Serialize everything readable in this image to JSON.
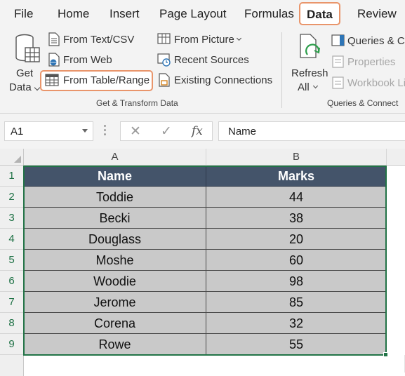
{
  "ribbon_tabs": {
    "file": "File",
    "home": "Home",
    "insert": "Insert",
    "page_layout": "Page Layout",
    "formulas": "Formulas",
    "data": "Data",
    "review": "Review"
  },
  "get_transform": {
    "get_data_line1": "Get",
    "get_data_line2": "Data",
    "from_text_csv": "From Text/CSV",
    "from_web": "From Web",
    "from_table_range": "From Table/Range",
    "from_picture": "From Picture",
    "recent_sources": "Recent Sources",
    "existing_connections": "Existing Connections",
    "group_label": "Get & Transform Data"
  },
  "queries": {
    "refresh_line1": "Refresh",
    "refresh_line2": "All",
    "queries_connections": "Queries & Co",
    "properties": "Properties",
    "workbook_links": "Workbook Li",
    "group_label": "Queries & Connect"
  },
  "formula_bar": {
    "name_box": "A1",
    "cancel_glyph": "✕",
    "enter_glyph": "✓",
    "fx_glyph": "fx",
    "formula": "Name"
  },
  "sheet": {
    "columns": [
      "A",
      "B"
    ],
    "row_numbers": [
      "1",
      "2",
      "3",
      "4",
      "5",
      "6",
      "7",
      "8",
      "9"
    ],
    "headers": [
      "Name",
      "Marks"
    ],
    "rows": [
      [
        "Toddie",
        "44"
      ],
      [
        "Becki",
        "38"
      ],
      [
        "Douglass",
        "20"
      ],
      [
        "Moshe",
        "60"
      ],
      [
        "Woodie",
        "98"
      ],
      [
        "Jerome",
        "85"
      ],
      [
        "Corena",
        "32"
      ],
      [
        "Rowe",
        "55"
      ]
    ]
  },
  "colors": {
    "accent_highlight": "#e9956b",
    "header_fill": "#44546a",
    "cell_fill": "#c9c9c9",
    "selection": "#217346"
  }
}
